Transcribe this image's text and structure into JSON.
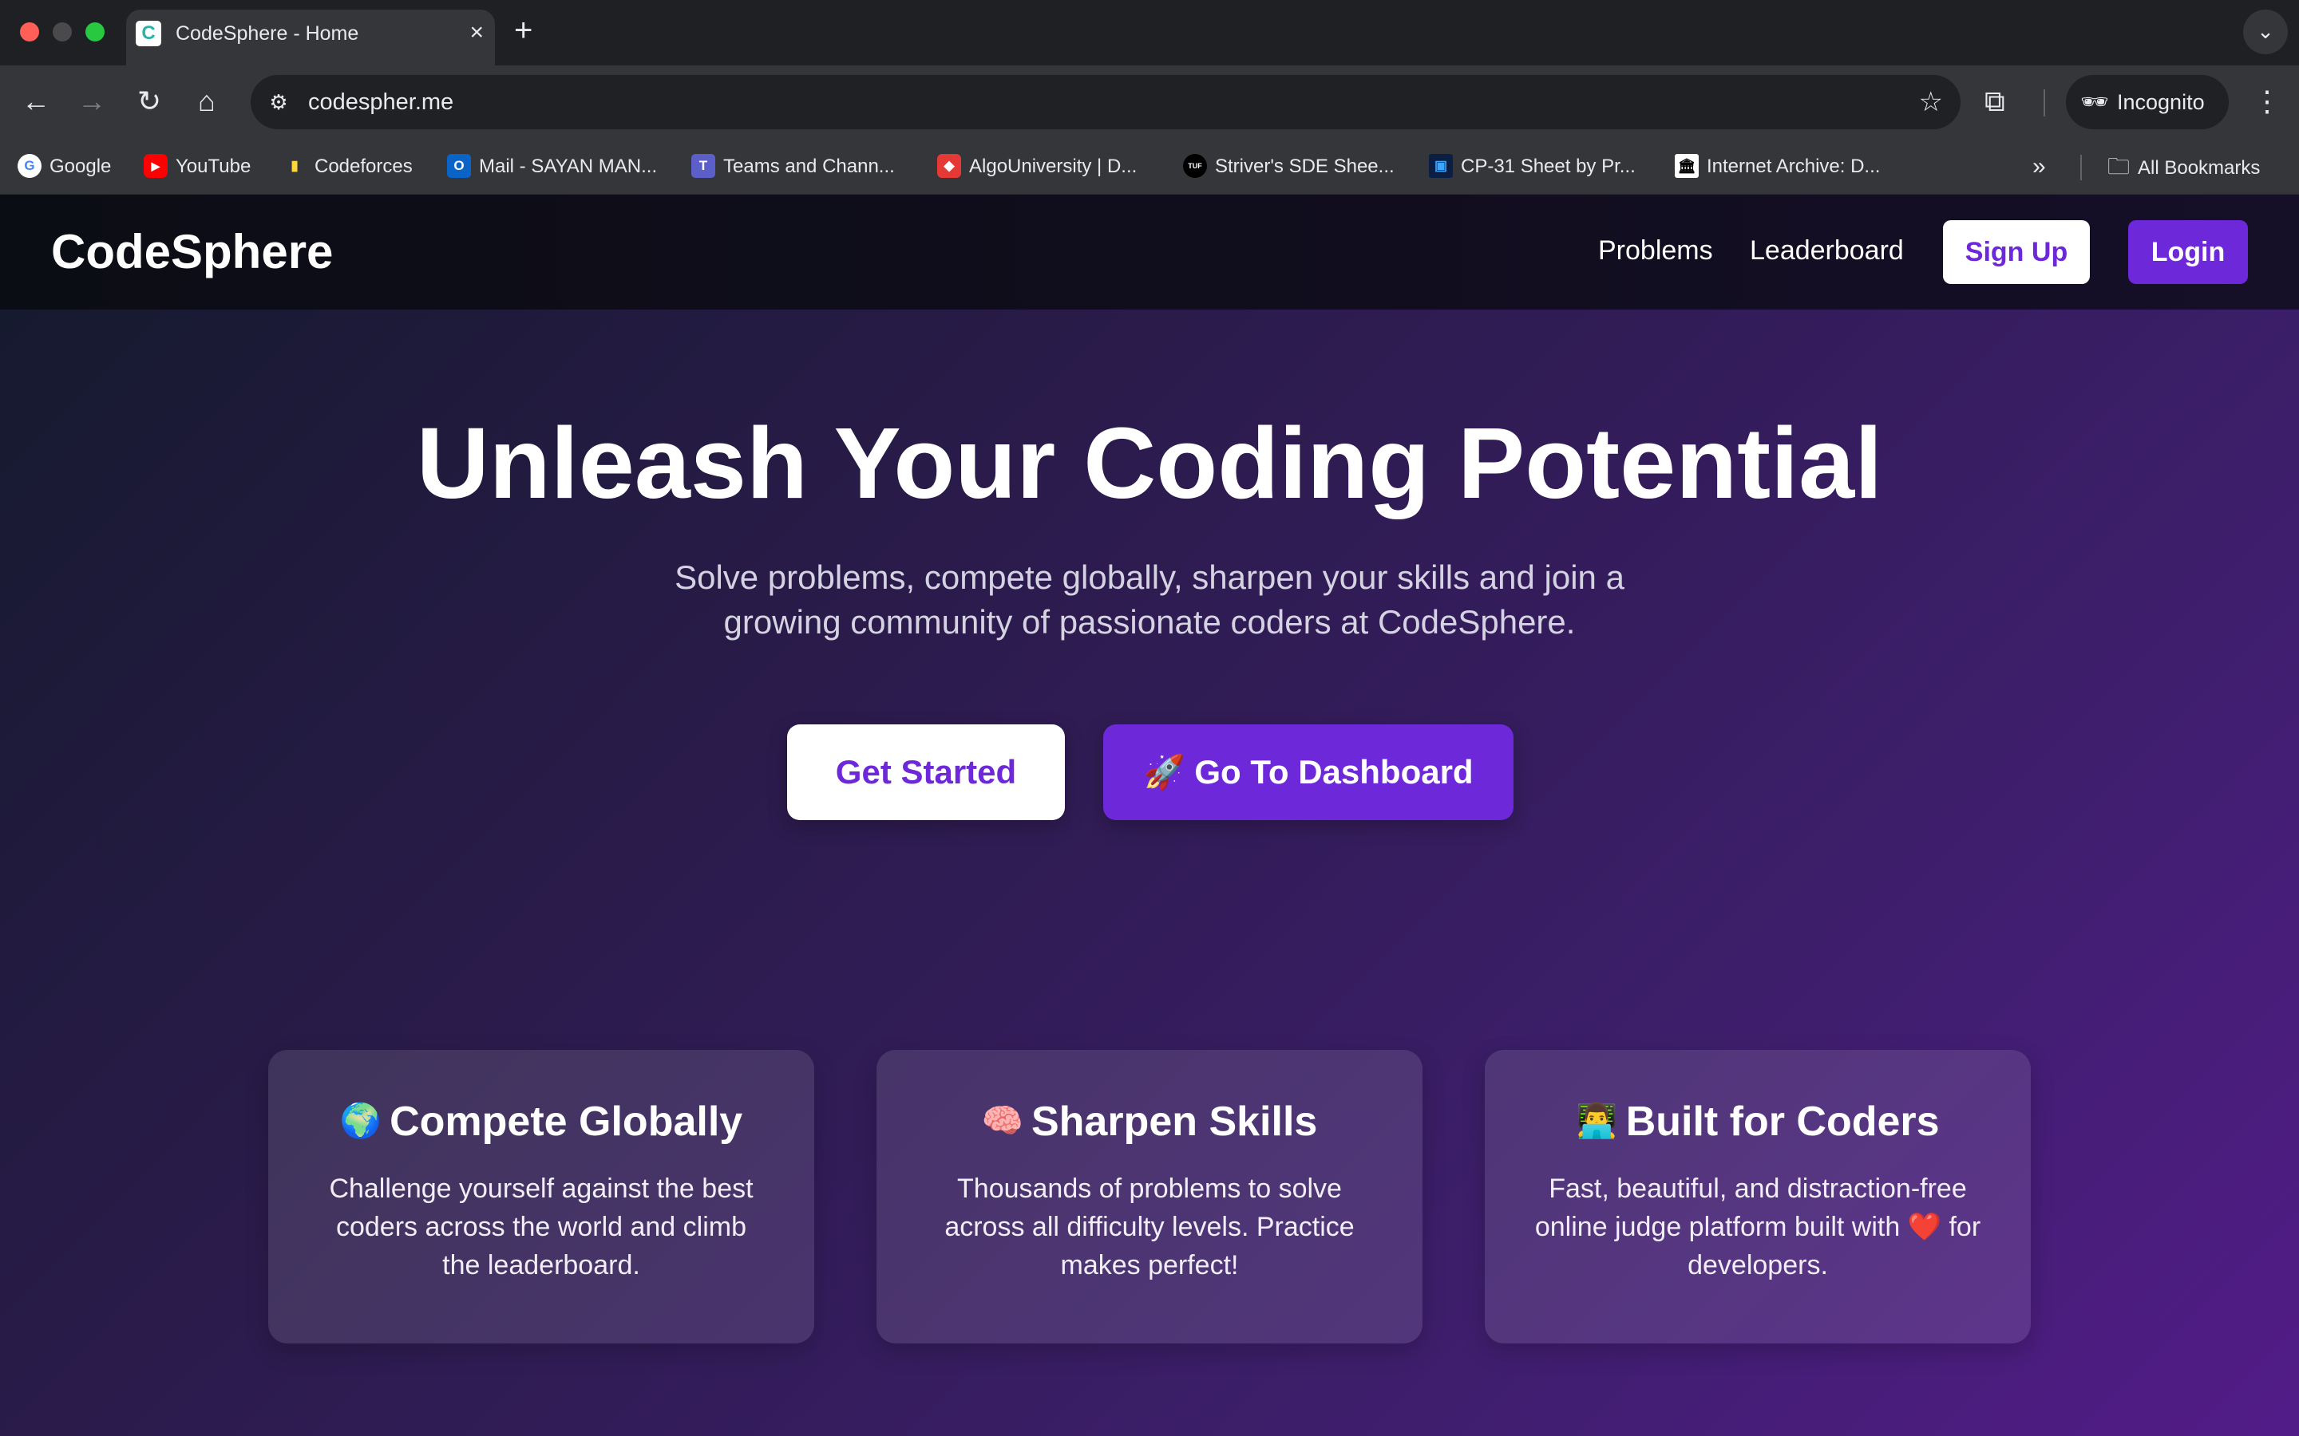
{
  "browser": {
    "tab_title": "CodeSphere - Home",
    "tab_favicon": "C",
    "url": "codespher.me",
    "incognito_label": "Incognito",
    "bookmarks": [
      {
        "label": "Google",
        "icon": "G",
        "color": "#ffffff",
        "text_color": "#4285f4"
      },
      {
        "label": "YouTube",
        "icon": "▶",
        "color": "#ff0000",
        "text_color": "#ffffff"
      },
      {
        "label": "Codeforces",
        "icon": "▮",
        "color": "#1f8acb",
        "text_color": "#ffd83a"
      },
      {
        "label": "Mail - SAYAN MAN...",
        "icon": "O",
        "color": "#0a64c8",
        "text_color": "#ffffff"
      },
      {
        "label": "Teams and Chann...",
        "icon": "T",
        "color": "#5b5fc7",
        "text_color": "#ffffff"
      },
      {
        "label": "AlgoUniversity | D...",
        "icon": "◆",
        "color": "#e53935",
        "text_color": "#ffffff"
      },
      {
        "label": "Striver's SDE Shee...",
        "icon": "TUF",
        "color": "#000000",
        "text_color": "#ffffff"
      },
      {
        "label": "CP-31 Sheet by Pr...",
        "icon": "▣",
        "color": "#1a73e8",
        "text_color": "#ffffff"
      },
      {
        "label": "Internet Archive: D...",
        "icon": "🏛",
        "color": "#ffffff",
        "text_color": "#000000"
      }
    ],
    "bookmarks_overflow": "»",
    "all_bookmarks_label": "All Bookmarks"
  },
  "site": {
    "brand": "CodeSphere",
    "nav": {
      "problems": "Problems",
      "leaderboard": "Leaderboard",
      "signup": "Sign Up",
      "login": "Login"
    },
    "hero": {
      "title": "Unleash Your Coding Potential",
      "subtitle": "Solve problems, compete globally, sharpen your skills and join a growing community of passionate coders at CodeSphere.",
      "cta_primary": "Get Started",
      "cta_secondary": "🚀 Go To Dashboard"
    },
    "features": [
      {
        "emoji": "🌍",
        "title": "Compete Globally",
        "text": "Challenge yourself against the best coders across the world and climb the leaderboard."
      },
      {
        "emoji": "🧠",
        "title": "Sharpen Skills",
        "text": "Thousands of problems to solve across all difficulty levels. Practice makes perfect!"
      },
      {
        "emoji": "👨‍💻",
        "title": "Built for Coders",
        "text": "Fast, beautiful, and distraction-free online judge platform built with ❤️ for developers."
      }
    ]
  },
  "colors": {
    "accent": "#6d28d9",
    "page_bg_start": "#141a2c",
    "page_bg_end": "#521c88"
  }
}
